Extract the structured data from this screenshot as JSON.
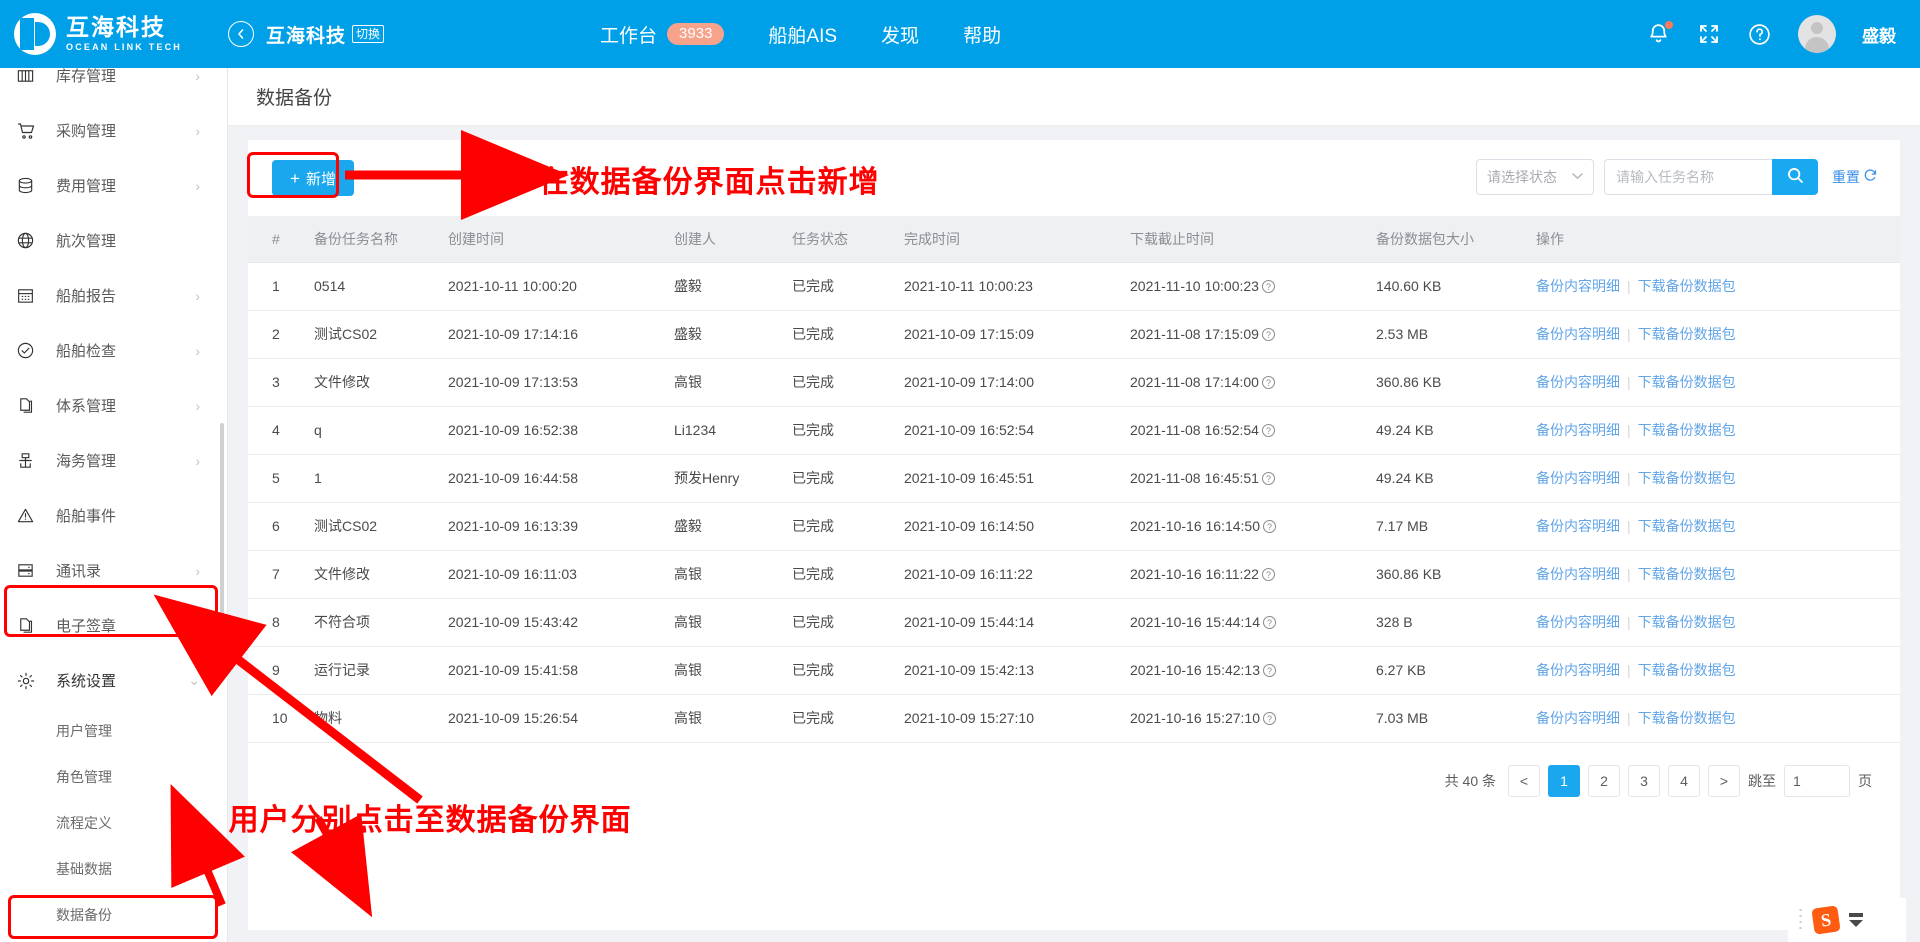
{
  "header": {
    "brand_cn": "互海科技",
    "brand_en": "OCEAN LINK TECH",
    "back_icon": "back-arrow-icon",
    "company": "互海科技",
    "switch_label": "切换",
    "nav": [
      {
        "label": "工作台",
        "badge": "3933"
      },
      {
        "label": "船舶AIS",
        "badge": ""
      },
      {
        "label": "发现",
        "badge": ""
      },
      {
        "label": "帮助",
        "badge": ""
      }
    ],
    "bell_icon": "bell-icon",
    "fullscreen_icon": "fullscreen-icon",
    "help_icon": "question-circle-icon",
    "user_name": "盛毅"
  },
  "sidebar": {
    "items": [
      {
        "label": "库存管理",
        "icon": "inventory-icon",
        "arrow": "›",
        "cut_off": true
      },
      {
        "label": "采购管理",
        "icon": "cart-icon",
        "arrow": "›"
      },
      {
        "label": "费用管理",
        "icon": "database-icon",
        "arrow": "›"
      },
      {
        "label": "航次管理",
        "icon": "globe-icon",
        "arrow": ""
      },
      {
        "label": "船舶报告",
        "icon": "calendar-icon",
        "arrow": "›"
      },
      {
        "label": "船舶检查",
        "icon": "check-circle-icon",
        "arrow": "›"
      },
      {
        "label": "体系管理",
        "icon": "copy-doc-icon",
        "arrow": "›"
      },
      {
        "label": "海务管理",
        "icon": "anchor-icon",
        "arrow": "›"
      },
      {
        "label": "船舶事件",
        "icon": "warning-triangle-icon",
        "arrow": ""
      },
      {
        "label": "通讯录",
        "icon": "contacts-icon",
        "arrow": "›"
      },
      {
        "label": "电子签章",
        "icon": "stamp-doc-icon",
        "arrow": "›"
      },
      {
        "label": "系统设置",
        "icon": "gear-icon",
        "arrow": "⌄",
        "active": true
      }
    ],
    "sub_items": [
      {
        "label": "用户管理",
        "arrow": ""
      },
      {
        "label": "角色管理",
        "arrow": ""
      },
      {
        "label": "流程定义",
        "arrow": ""
      },
      {
        "label": "基础数据",
        "arrow": "›"
      },
      {
        "label": "数据备份",
        "arrow": "",
        "highlighted": true
      }
    ]
  },
  "page": {
    "title": "数据备份"
  },
  "toolbar": {
    "add_label": "新增",
    "add_plus": "+",
    "status_select_value": "请选择状态",
    "search_placeholder": "请输入任务名称",
    "search_value": "",
    "search_icon": "search-icon",
    "reset_label": "重置",
    "reset_icon": "refresh-icon"
  },
  "table": {
    "columns": [
      "#",
      "备份任务名称",
      "创建时间",
      "创建人",
      "任务状态",
      "完成时间",
      "下载截止时间",
      "备份数据包大小",
      "操作"
    ],
    "action_detail": "备份内容明细",
    "action_download": "下载备份数据包",
    "action_separator": "|",
    "rows": [
      {
        "idx": "1",
        "name": "0514",
        "ctime": "2021-10-11 10:00:20",
        "user": "盛毅",
        "state": "已完成",
        "ftime": "2021-10-11 10:00:23",
        "dtime": "2021-11-10 10:00:23",
        "size": "140.60 KB"
      },
      {
        "idx": "2",
        "name": "测试CS02",
        "ctime": "2021-10-09 17:14:16",
        "user": "盛毅",
        "state": "已完成",
        "ftime": "2021-10-09 17:15:09",
        "dtime": "2021-11-08 17:15:09",
        "size": "2.53 MB"
      },
      {
        "idx": "3",
        "name": "文件修改",
        "ctime": "2021-10-09 17:13:53",
        "user": "高银",
        "state": "已完成",
        "ftime": "2021-10-09 17:14:00",
        "dtime": "2021-11-08 17:14:00",
        "size": "360.86 KB"
      },
      {
        "idx": "4",
        "name": "q",
        "ctime": "2021-10-09 16:52:38",
        "user": "Li1234",
        "state": "已完成",
        "ftime": "2021-10-09 16:52:54",
        "dtime": "2021-11-08 16:52:54",
        "size": "49.24 KB"
      },
      {
        "idx": "5",
        "name": "1",
        "ctime": "2021-10-09 16:44:58",
        "user": "预发Henry",
        "state": "已完成",
        "ftime": "2021-10-09 16:45:51",
        "dtime": "2021-11-08 16:45:51",
        "size": "49.24 KB"
      },
      {
        "idx": "6",
        "name": "测试CS02",
        "ctime": "2021-10-09 16:13:39",
        "user": "盛毅",
        "state": "已完成",
        "ftime": "2021-10-09 16:14:50",
        "dtime": "2021-10-16 16:14:50",
        "size": "7.17 MB"
      },
      {
        "idx": "7",
        "name": "文件修改",
        "ctime": "2021-10-09 16:11:03",
        "user": "高银",
        "state": "已完成",
        "ftime": "2021-10-09 16:11:22",
        "dtime": "2021-10-16 16:11:22",
        "size": "360.86 KB"
      },
      {
        "idx": "8",
        "name": "不符合项",
        "ctime": "2021-10-09 15:43:42",
        "user": "高银",
        "state": "已完成",
        "ftime": "2021-10-09 15:44:14",
        "dtime": "2021-10-16 15:44:14",
        "size": "328 B"
      },
      {
        "idx": "9",
        "name": "运行记录",
        "ctime": "2021-10-09 15:41:58",
        "user": "高银",
        "state": "已完成",
        "ftime": "2021-10-09 15:42:13",
        "dtime": "2021-10-16 15:42:13",
        "size": "6.27 KB"
      },
      {
        "idx": "10",
        "name": "物料",
        "ctime": "2021-10-09 15:26:54",
        "user": "高银",
        "state": "已完成",
        "ftime": "2021-10-09 15:27:10",
        "dtime": "2021-10-16 15:27:10",
        "size": "7.03 MB"
      }
    ]
  },
  "pagination": {
    "total_label": "共 40 条",
    "prev": "<",
    "pages": [
      "1",
      "2",
      "3",
      "4"
    ],
    "current": "1",
    "next": ">",
    "jump_label": "跳至",
    "jump_value": "1",
    "page_unit": "页"
  },
  "annotations": [
    {
      "id": "step1",
      "text": "1、用户分别点击至数据备份界面"
    },
    {
      "id": "step2",
      "text": "2、在数据备份界面点击新增"
    }
  ],
  "ime": {
    "logo": "S",
    "icon": "sogou-ime-icon"
  },
  "colors": {
    "header_blue": "#00a0e9",
    "primary_blue": "#1ba7ee",
    "annotation_red": "#ff0000",
    "badge_orange": "#f7a38b",
    "link_blue": "#61a5e8"
  }
}
